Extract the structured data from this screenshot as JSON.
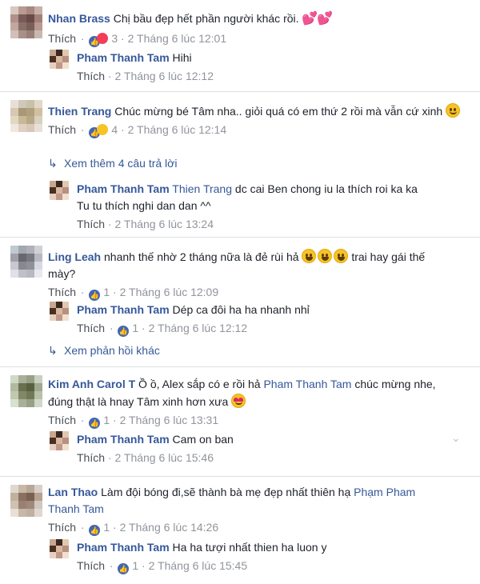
{
  "comments": [
    {
      "author": "Nhan Brass",
      "text": "Chị bầu đẹp hết phần người khác rồi.",
      "emoji": "💕💕",
      "like_label": "Thích",
      "reaction_count": "3",
      "time": "2 Tháng 6 lúc 12:01",
      "reply": {
        "author": "Pham Thanh Tam",
        "text": "Hihi",
        "like_label": "Thích",
        "time": "2 Tháng 6 lúc 12:12"
      }
    },
    {
      "author": "Thien Trang",
      "text": "Chúc mừng bé Tâm nha.. giỏi quá có em thứ 2 rồi mà vẫn cứ xinh",
      "like_label": "Thích",
      "reaction_count": "4",
      "time": "2 Tháng 6 lúc 12:14",
      "more_replies": "Xem thêm 4 câu trả lời",
      "reply": {
        "author": "Pham Thanh Tam",
        "mention": "Thien Trang",
        "text": "dc cai Ben chong iu la thích roi ka ka",
        "text2": "Tu tu thích nghi dan dan ^^",
        "like_label": "Thích",
        "time": "2 Tháng 6 lúc 13:24"
      }
    },
    {
      "author": "Ling Leah",
      "text": "nhanh thế nhờ 2 tháng nữa là đẻ rùi hả",
      "text_after": "trai hay gái thế",
      "text2": "mày?",
      "like_label": "Thích",
      "reaction_count": "1",
      "time": "2 Tháng 6 lúc 12:09",
      "reply": {
        "author": "Pham Thanh Tam",
        "text": "Dép ca đôi ha ha nhanh nhỉ",
        "like_label": "Thích",
        "reaction_count": "1",
        "time": "2 Tháng 6 lúc 12:12"
      },
      "more_replies": "Xem phản hồi khác"
    },
    {
      "author": "Kim Anh Carol T",
      "text": "Ồ ồ, Alex sắp có e rồi hả",
      "mention": "Pham Thanh Tam",
      "text_after": "chúc mừng nhe,",
      "text2": "đúng thật là hnay Tâm xinh hơn xưa",
      "like_label": "Thích",
      "reaction_count": "1",
      "time": "2 Tháng 6 lúc 13:31",
      "reply": {
        "author": "Pham Thanh Tam",
        "text": "Cam on ban",
        "like_label": "Thích",
        "time": "2 Tháng 6 lúc 15:46"
      }
    },
    {
      "author": "Lan Thao",
      "text": "Làm đội bóng đi,sẽ thành bà mẹ đẹp nhất thiên hạ",
      "mention": "Phạm Pham",
      "mention2": "Thanh Tam",
      "like_label": "Thích",
      "reaction_count": "1",
      "time": "2 Tháng 6 lúc 14:26",
      "reply": {
        "author": "Pham Thanh Tam",
        "text": "Ha ha tượi nhất thien ha luon y",
        "like_label": "Thích",
        "reaction_count": "1",
        "time": "2 Tháng 6 lúc 15:45"
      }
    }
  ],
  "icons": {
    "like": "like-reaction-icon",
    "love": "love-reaction-icon",
    "haha": "haha-reaction-icon",
    "reply_arrow": "reply-arrow-icon",
    "chevron": "chevron-down-icon"
  },
  "colors": {
    "link": "#365899",
    "meta": "#90949c",
    "like_blue": "#4267b2"
  }
}
